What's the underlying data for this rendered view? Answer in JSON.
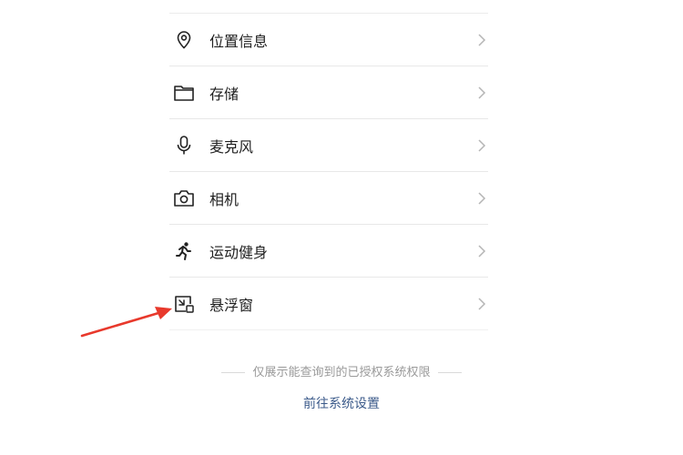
{
  "permissions": [
    {
      "label": "位置信息",
      "icon": "location-pin-icon"
    },
    {
      "label": "存储",
      "icon": "folder-icon"
    },
    {
      "label": "麦克风",
      "icon": "microphone-icon"
    },
    {
      "label": "相机",
      "icon": "camera-icon"
    },
    {
      "label": "运动健身",
      "icon": "running-person-icon"
    },
    {
      "label": "悬浮窗",
      "icon": "floating-window-icon"
    }
  ],
  "footer": {
    "note": "仅展示能查询到的已授权系统权限",
    "link": "前往系统设置"
  },
  "colors": {
    "annotation_arrow": "#e8392c",
    "link": "#3b5a8a"
  }
}
